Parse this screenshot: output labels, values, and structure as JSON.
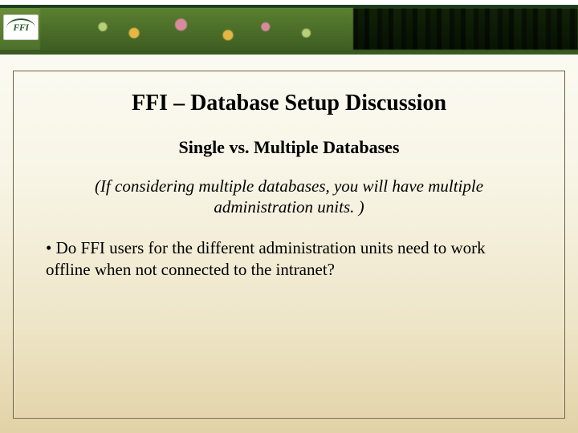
{
  "logo": {
    "text": "FFI"
  },
  "slide": {
    "title": "FFI – Database Setup Discussion",
    "subtitle": "Single vs. Multiple Databases",
    "note": "(If considering multiple databases, you will have multiple administration units. )",
    "bullet1": "• Do FFI users for the different administration units need to work offline when not connected to the intranet?"
  }
}
